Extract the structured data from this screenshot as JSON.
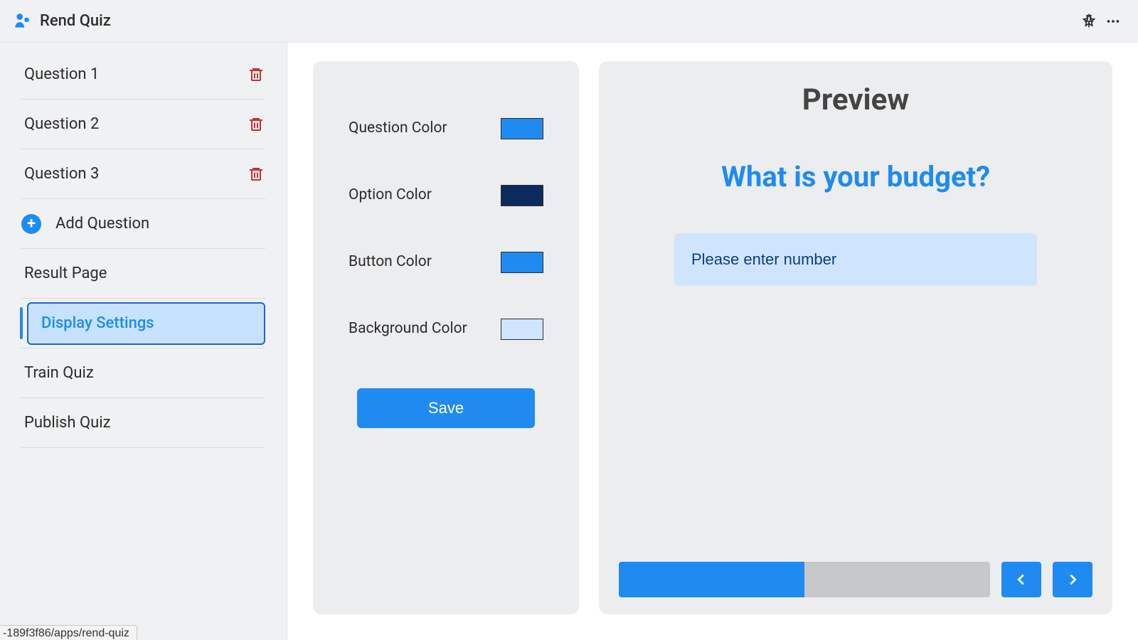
{
  "header": {
    "title": "Rend Quiz"
  },
  "sidebar": {
    "questions": [
      "Question 1",
      "Question 2",
      "Question 3"
    ],
    "add_label": "Add Question",
    "items": [
      "Result Page",
      "Display Settings",
      "Train Quiz",
      "Publish Quiz"
    ],
    "active_index": 1
  },
  "settings": {
    "rows": [
      {
        "label": "Question Color",
        "color": "#1f8bf1"
      },
      {
        "label": "Option Color",
        "color": "#0c2b5c"
      },
      {
        "label": "Button Color",
        "color": "#1f8bf1"
      },
      {
        "label": "Background Color",
        "color": "#cfe5ff"
      }
    ],
    "save_label": "Save"
  },
  "preview": {
    "title": "Preview",
    "question": "What is your budget?",
    "placeholder": "Please enter number",
    "progress_percent": 50
  },
  "status_fragment": "-189f3f86/apps/rend-quiz"
}
